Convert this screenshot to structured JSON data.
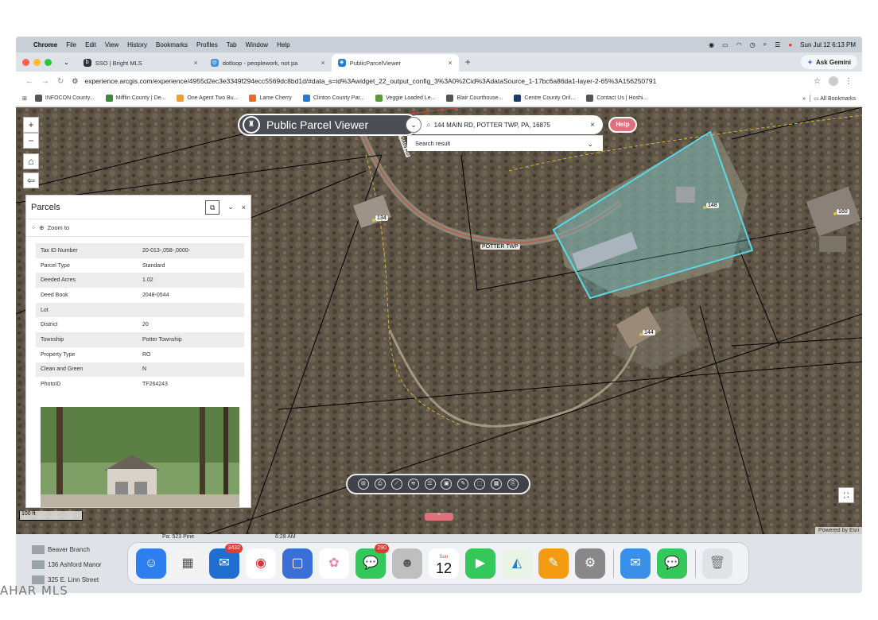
{
  "menubar": {
    "app": "Chrome",
    "items": [
      "File",
      "Edit",
      "View",
      "History",
      "Bookmarks",
      "Profiles",
      "Tab",
      "Window",
      "Help"
    ],
    "clock": "Sun Jul 12  6:13 PM"
  },
  "tabs": [
    {
      "title": "SSO | Bright MLS",
      "icon": "bright-mls-icon"
    },
    {
      "title": "dotloop - peoplework, not pa",
      "icon": "dotloop-icon"
    },
    {
      "title": "PublicParcelViewer",
      "icon": "arcgis-icon"
    }
  ],
  "gemini_label": "Ask Gemini",
  "url": "experience.arcgis.com/experience/4955d2ec3e3349f294ecc5569dc8bd1d/#data_s=id%3Awidget_22_output_config_3%3A0%2Cid%3AdataSource_1-17bc6a86da1-layer-2-65%3A156250791",
  "bookmarks": [
    "INFOCON County...",
    "Mifflin County | De...",
    "One Agent Two Bu...",
    "Lame Cherry",
    "Clinton County Par...",
    "Veggie Loaded Le...",
    "Blair Courthouse...",
    "Centre County Onl...",
    "Contact Us | Hoshi..."
  ],
  "all_bookmarks": "All Bookmarks",
  "app_title": "Public Parcel Viewer",
  "search": {
    "value": "144 MAIN RD, POTTER TWP, PA, 16875",
    "result_label": "Search result"
  },
  "help_label": "Help",
  "map": {
    "road_label": "POTTER TWP",
    "road_label2": "MAIN RD",
    "parcel_labels": [
      "134",
      "148",
      "160",
      "144"
    ],
    "scale": "100 ft",
    "attribution": "Powered by Esri",
    "highlight_color": "#59d8e8"
  },
  "parcels_panel": {
    "title": "Parcels",
    "zoom_to": "Zoom to",
    "rows": [
      {
        "key": "Tax ID Number",
        "value": "20-013-,058-,0000-"
      },
      {
        "key": "Parcel Type",
        "value": "Standard"
      },
      {
        "key": "Deeded Acres",
        "value": "1.02"
      },
      {
        "key": "Deed Book",
        "value": "2048-0544"
      },
      {
        "key": "Lot",
        "value": ""
      },
      {
        "key": "District",
        "value": "20"
      },
      {
        "key": "Township",
        "value": "Potter Township"
      },
      {
        "key": "Property Type",
        "value": "RO"
      },
      {
        "key": "Clean and Green",
        "value": "N"
      },
      {
        "key": "PhotoID",
        "value": "TF264243"
      }
    ]
  },
  "bottom": {
    "peek_text": "Pa: 523 Pine",
    "peek_time": "6:28 AM",
    "listings": [
      "Beaver Branch",
      "136 Ashford Manor",
      "325 E. Linn Street"
    ]
  },
  "dock": {
    "badges": {
      "outlook": "3432",
      "messages": "290"
    },
    "calendar_day": "Sun",
    "calendar_date": "12"
  },
  "footer_text": "AHAR MLS"
}
